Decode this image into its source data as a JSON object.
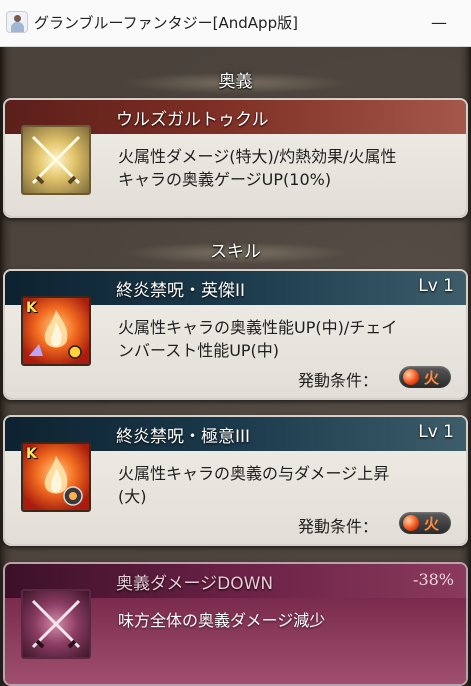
{
  "window": {
    "title": "グランブルーファンタジー[AndApp版]",
    "minimize_label": "—"
  },
  "sections": {
    "ougi_header": "奥義",
    "skill_header": "スキル"
  },
  "ougi": {
    "name": "ウルズガルトゥクル",
    "desc_line1": "火属性ダメージ(特大)/灼熱効果/火属性",
    "desc_line2": "キャラの奥義ゲージUP(10%)",
    "icon": "crossed-swords-icon"
  },
  "skills": [
    {
      "name": "終炎禁呪・英傑II",
      "level": "Lv 1",
      "desc_line1": "火属性キャラの奥義性能UP(中)/チェイ",
      "desc_line2": "ンバースト性能UP(中)",
      "condition_label": "発動条件：",
      "condition_value": "火",
      "badge": "K",
      "icon": "flame-icon"
    },
    {
      "name": "終炎禁呪・極意III",
      "level": "Lv 1",
      "desc_line1": "火属性キャラの奥義の与ダメージ上昇",
      "desc_line2": "(大)",
      "condition_label": "発動条件：",
      "condition_value": "火",
      "badge": "K",
      "icon": "flame-icon"
    }
  ],
  "debuff": {
    "name": "奥義ダメージDOWN",
    "value": "-38%",
    "desc": "味方全体の奥義ダメージ減少",
    "icon": "crossed-swords-icon"
  },
  "colors": {
    "fire": "#f2521a",
    "ougi_header": "#7e2e24",
    "skill_header": "#1b3a4c",
    "debuff": "#7a2a4c"
  }
}
